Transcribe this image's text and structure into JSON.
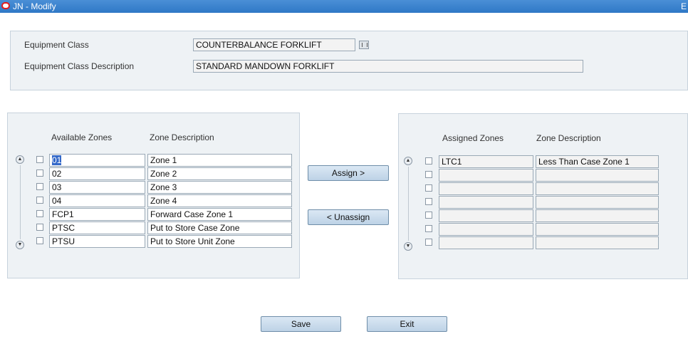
{
  "window": {
    "title": "JN - Modify",
    "edge_char": "E"
  },
  "header": {
    "equipment_class_label": "Equipment Class",
    "equipment_class_value": "COUNTERBALANCE FORKLIFT",
    "equipment_class_desc_label": "Equipment Class Description",
    "equipment_class_desc_value": "STANDARD MANDOWN FORKLIFT"
  },
  "available": {
    "col_zone": "Available Zones",
    "col_desc": "Zone Description",
    "rows": [
      {
        "zone": "01",
        "desc": "Zone 1"
      },
      {
        "zone": "02",
        "desc": "Zone 2"
      },
      {
        "zone": "03",
        "desc": "Zone 3"
      },
      {
        "zone": "04",
        "desc": "Zone 4"
      },
      {
        "zone": "FCP1",
        "desc": "Forward Case Zone 1"
      },
      {
        "zone": "PTSC",
        "desc": "Put to Store Case Zone"
      },
      {
        "zone": "PTSU",
        "desc": "Put to Store Unit Zone"
      }
    ]
  },
  "assigned": {
    "col_zone": "Assigned Zones",
    "col_desc": "Zone Description",
    "rows": [
      {
        "zone": "LTC1",
        "desc": "Less Than Case Zone 1"
      },
      {
        "zone": "",
        "desc": ""
      },
      {
        "zone": "",
        "desc": ""
      },
      {
        "zone": "",
        "desc": ""
      },
      {
        "zone": "",
        "desc": ""
      },
      {
        "zone": "",
        "desc": ""
      },
      {
        "zone": "",
        "desc": ""
      }
    ]
  },
  "buttons": {
    "assign": "Assign >",
    "unassign": "< Unassign",
    "save": "Save",
    "exit": "Exit"
  }
}
